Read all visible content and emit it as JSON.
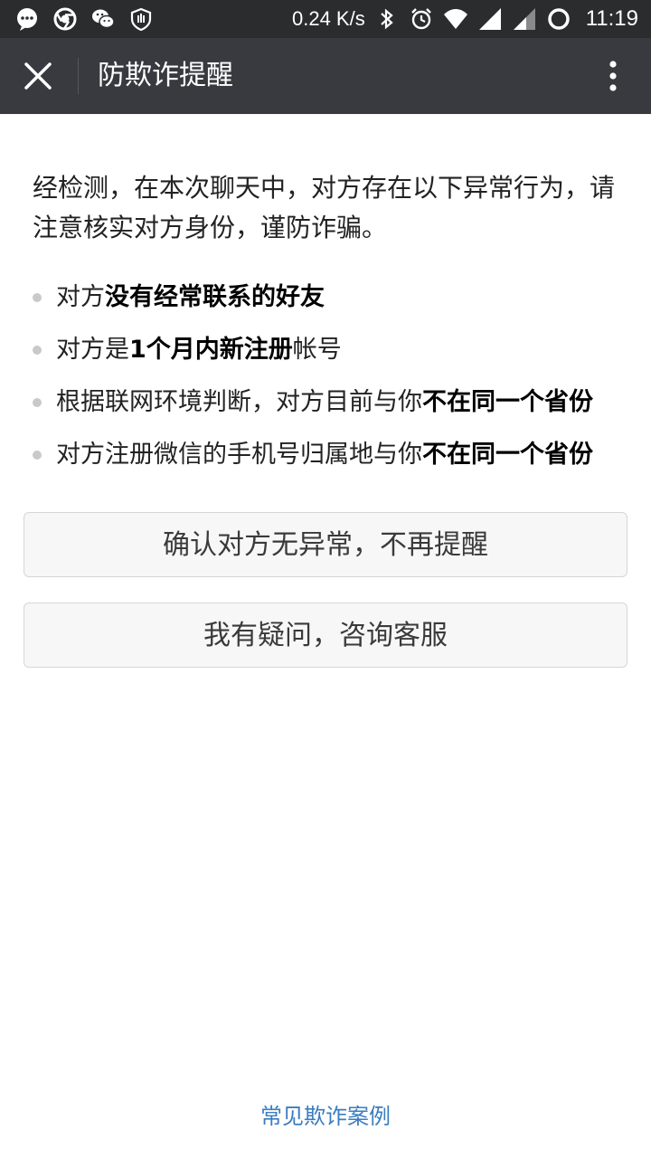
{
  "status_bar": {
    "speed": "0.24 K/s",
    "time": "11:19"
  },
  "title_bar": {
    "title": "防欺诈提醒"
  },
  "content": {
    "intro": "经检测，在本次聊天中，对方存在以下异常行为，请注意核实对方身份，谨防诈骗。",
    "items": [
      {
        "prefix": "对方",
        "bold": "没有经常联系的好友",
        "suffix": ""
      },
      {
        "prefix": "对方是",
        "bold": "1个月内新注册",
        "suffix": "帐号"
      },
      {
        "prefix": "根据联网环境判断，对方目前与你",
        "bold": "不在同一个省份",
        "suffix": ""
      },
      {
        "prefix": "对方注册微信的手机号归属地与你",
        "bold": "不在同一个省份",
        "suffix": ""
      }
    ]
  },
  "buttons": {
    "confirm_label": "确认对方无异常，不再提醒",
    "consult_label": "我有疑问，咨询客服"
  },
  "footer": {
    "link_label": "常见欺诈案例"
  },
  "colors": {
    "status_bar_bg": "#2b2c2e",
    "title_bar_bg": "#393a3f",
    "link": "#3a7dbf"
  }
}
